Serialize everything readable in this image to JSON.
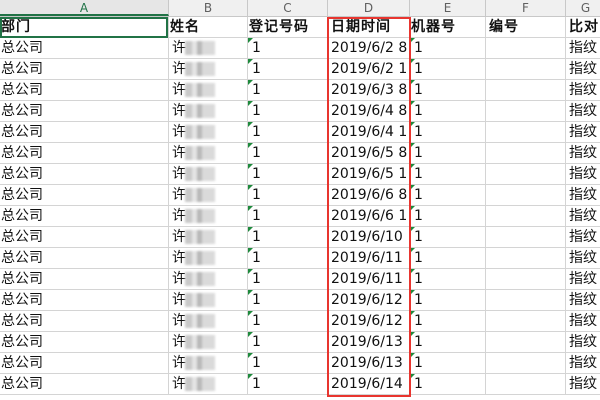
{
  "columns": [
    "A",
    "B",
    "C",
    "D",
    "E",
    "F",
    "G"
  ],
  "headers": {
    "dept": "部门",
    "name": "姓名",
    "reg_no": "登记号码",
    "datetime": "日期时间",
    "machine": "机器号",
    "code": "编号",
    "compare": "比对"
  },
  "rows": [
    {
      "dept": "总公司",
      "name": "许",
      "reg_no": "1",
      "datetime": "2019/6/2 8",
      "machine": "1",
      "compare": "指纹"
    },
    {
      "dept": "总公司",
      "name": "许",
      "reg_no": "1",
      "datetime": "2019/6/2 1",
      "machine": "1",
      "compare": "指纹"
    },
    {
      "dept": "总公司",
      "name": "许",
      "reg_no": "1",
      "datetime": "2019/6/3 8",
      "machine": "1",
      "compare": "指纹"
    },
    {
      "dept": "总公司",
      "name": "许",
      "reg_no": "1",
      "datetime": "2019/6/4 8",
      "machine": "1",
      "compare": "指纹"
    },
    {
      "dept": "总公司",
      "name": "许",
      "reg_no": "1",
      "datetime": "2019/6/4 1",
      "machine": "1",
      "compare": "指纹"
    },
    {
      "dept": "总公司",
      "name": "许",
      "reg_no": "1",
      "datetime": "2019/6/5 8",
      "machine": "1",
      "compare": "指纹"
    },
    {
      "dept": "总公司",
      "name": "许",
      "reg_no": "1",
      "datetime": "2019/6/5 1",
      "machine": "1",
      "compare": "指纹"
    },
    {
      "dept": "总公司",
      "name": "许",
      "reg_no": "1",
      "datetime": "2019/6/6 8",
      "machine": "1",
      "compare": "指纹"
    },
    {
      "dept": "总公司",
      "name": "许",
      "reg_no": "1",
      "datetime": "2019/6/6 1",
      "machine": "1",
      "compare": "指纹"
    },
    {
      "dept": "总公司",
      "name": "许",
      "reg_no": "1",
      "datetime": "2019/6/10",
      "machine": "1",
      "compare": "指纹"
    },
    {
      "dept": "总公司",
      "name": "许",
      "reg_no": "1",
      "datetime": "2019/6/11",
      "machine": "1",
      "compare": "指纹"
    },
    {
      "dept": "总公司",
      "name": "许",
      "reg_no": "1",
      "datetime": "2019/6/11",
      "machine": "1",
      "compare": "指纹"
    },
    {
      "dept": "总公司",
      "name": "许",
      "reg_no": "1",
      "datetime": "2019/6/12",
      "machine": "1",
      "compare": "指纹"
    },
    {
      "dept": "总公司",
      "name": "许",
      "reg_no": "1",
      "datetime": "2019/6/12",
      "machine": "1",
      "compare": "指纹"
    },
    {
      "dept": "总公司",
      "name": "许",
      "reg_no": "1",
      "datetime": "2019/6/13",
      "machine": "1",
      "compare": "指纹"
    },
    {
      "dept": "总公司",
      "name": "许",
      "reg_no": "1",
      "datetime": "2019/6/13",
      "machine": "1",
      "compare": "指纹"
    },
    {
      "dept": "总公司",
      "name": "许",
      "reg_no": "1",
      "datetime": "2019/6/14",
      "machine": "1",
      "compare": "指纹"
    }
  ],
  "colors": {
    "active_cell_border": "#217346",
    "highlight_box": "#e8352f",
    "triangle": "#1e8a3c"
  }
}
